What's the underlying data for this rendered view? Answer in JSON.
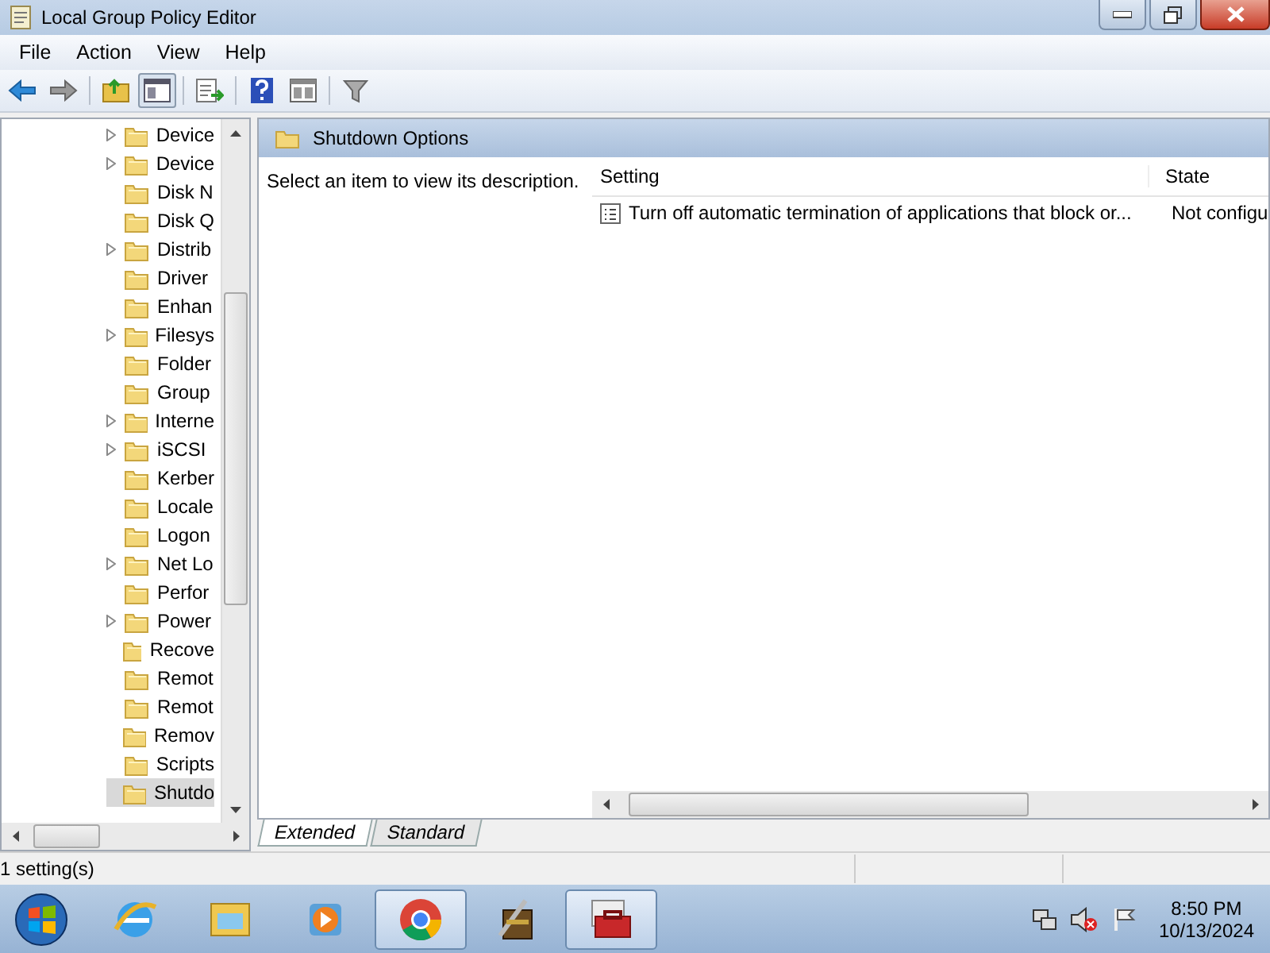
{
  "window": {
    "title": "Local Group Policy Editor"
  },
  "menu": [
    "File",
    "Action",
    "View",
    "Help"
  ],
  "tree": [
    {
      "label": "Device",
      "expandable": true,
      "selected": false
    },
    {
      "label": "Device",
      "expandable": true,
      "selected": false
    },
    {
      "label": "Disk N",
      "expandable": false,
      "selected": false
    },
    {
      "label": "Disk Q",
      "expandable": false,
      "selected": false
    },
    {
      "label": "Distrib",
      "expandable": true,
      "selected": false
    },
    {
      "label": "Driver",
      "expandable": false,
      "selected": false
    },
    {
      "label": "Enhan",
      "expandable": false,
      "selected": false
    },
    {
      "label": "Filesys",
      "expandable": true,
      "selected": false
    },
    {
      "label": "Folder",
      "expandable": false,
      "selected": false
    },
    {
      "label": "Group",
      "expandable": false,
      "selected": false
    },
    {
      "label": "Interne",
      "expandable": true,
      "selected": false
    },
    {
      "label": "iSCSI",
      "expandable": true,
      "selected": false
    },
    {
      "label": "Kerber",
      "expandable": false,
      "selected": false
    },
    {
      "label": "Locale",
      "expandable": false,
      "selected": false
    },
    {
      "label": "Logon",
      "expandable": false,
      "selected": false
    },
    {
      "label": "Net Lo",
      "expandable": true,
      "selected": false
    },
    {
      "label": "Perfor",
      "expandable": false,
      "selected": false
    },
    {
      "label": "Power",
      "expandable": true,
      "selected": false
    },
    {
      "label": "Recove",
      "expandable": false,
      "selected": false
    },
    {
      "label": "Remot",
      "expandable": false,
      "selected": false
    },
    {
      "label": "Remot",
      "expandable": false,
      "selected": false
    },
    {
      "label": "Remov",
      "expandable": false,
      "selected": false
    },
    {
      "label": "Scripts",
      "expandable": false,
      "selected": false
    },
    {
      "label": "Shutdo",
      "expandable": false,
      "selected": true
    }
  ],
  "pane": {
    "title": "Shutdown Options",
    "description": "Select an item to view its description."
  },
  "table": {
    "columns": [
      "Setting",
      "State"
    ],
    "rows": [
      {
        "setting": "Turn off automatic termination of applications that block or...",
        "state": "Not configu"
      }
    ]
  },
  "tabs": [
    {
      "label": "Extended",
      "selected": true
    },
    {
      "label": "Standard",
      "selected": false
    }
  ],
  "status_bar": "1 setting(s)",
  "taskbar": {
    "apps": [
      {
        "kind": "ie",
        "active": false
      },
      {
        "kind": "explorer",
        "active": false
      },
      {
        "kind": "media",
        "active": false
      },
      {
        "kind": "chrome",
        "active": true
      },
      {
        "kind": "archive",
        "active": false
      },
      {
        "kind": "toolbox",
        "active": true
      }
    ],
    "time": "8:50 PM",
    "date": "10/13/2024"
  }
}
